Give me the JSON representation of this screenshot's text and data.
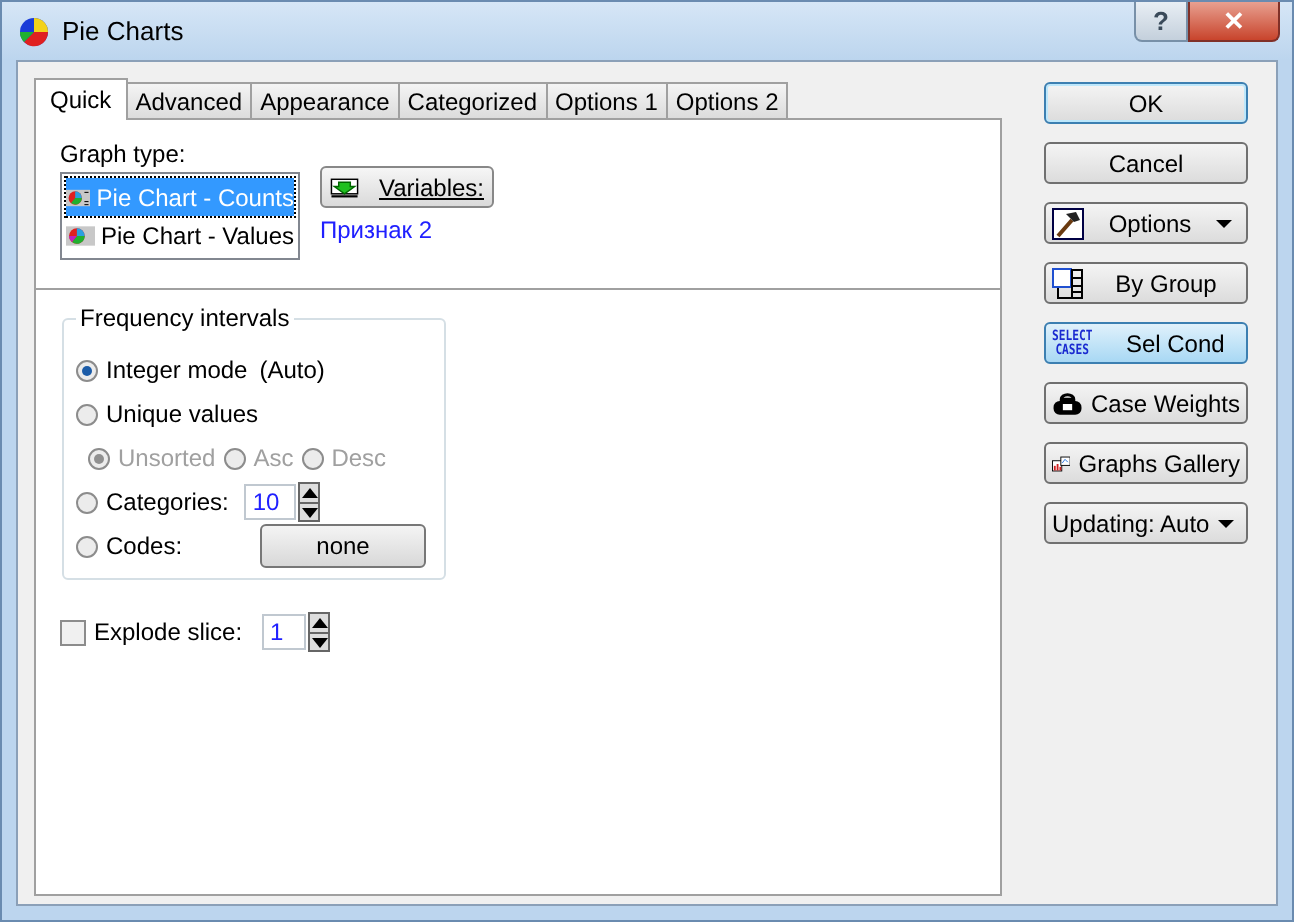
{
  "window": {
    "title": "Pie Charts",
    "help": "?",
    "close": "✕"
  },
  "tabs": [
    {
      "label": "Quick",
      "selected": true
    },
    {
      "label": "Advanced",
      "selected": false
    },
    {
      "label": "Appearance",
      "selected": false
    },
    {
      "label": "Categorized",
      "selected": false
    },
    {
      "label": "Options 1",
      "selected": false
    },
    {
      "label": "Options 2",
      "selected": false
    }
  ],
  "graph_type": {
    "label": "Graph type:",
    "items": [
      {
        "label": "Pie Chart - Counts",
        "selected": true
      },
      {
        "label": "Pie Chart - Values",
        "selected": false
      }
    ]
  },
  "variables": {
    "button": "Variables:",
    "value": "Признак 2"
  },
  "frequency": {
    "title": "Frequency intervals",
    "options": [
      {
        "kind": "radio",
        "label": "Integer mode",
        "note": "(Auto)",
        "selected": true
      },
      {
        "kind": "radio",
        "label": "Unique values",
        "selected": false
      },
      {
        "kind": "subradios",
        "items": [
          {
            "label": "Unsorted",
            "selected": true
          },
          {
            "label": "Asc",
            "selected": false
          },
          {
            "label": "Desc",
            "selected": false
          }
        ],
        "disabled": true
      },
      {
        "kind": "spin",
        "label": "Categories:",
        "value": "10",
        "selected": false
      },
      {
        "kind": "button",
        "label": "Codes:",
        "button": "none",
        "selected": false
      }
    ]
  },
  "explode": {
    "label": "Explode slice:",
    "checked": false,
    "value": "1"
  },
  "side_buttons": [
    {
      "kind": "ok",
      "label": "OK"
    },
    {
      "kind": "plain",
      "label": "Cancel"
    },
    {
      "kind": "options",
      "label": "Options"
    },
    {
      "kind": "bygroup",
      "label": "By Group"
    },
    {
      "kind": "selcond",
      "label": "Sel Cond",
      "icon_text": [
        "SELECT",
        "CASES"
      ]
    },
    {
      "kind": "weights",
      "label": "Case Weights"
    },
    {
      "kind": "gallery",
      "label": "Graphs Gallery"
    },
    {
      "kind": "dropdown",
      "label": "Updating: Auto"
    }
  ]
}
